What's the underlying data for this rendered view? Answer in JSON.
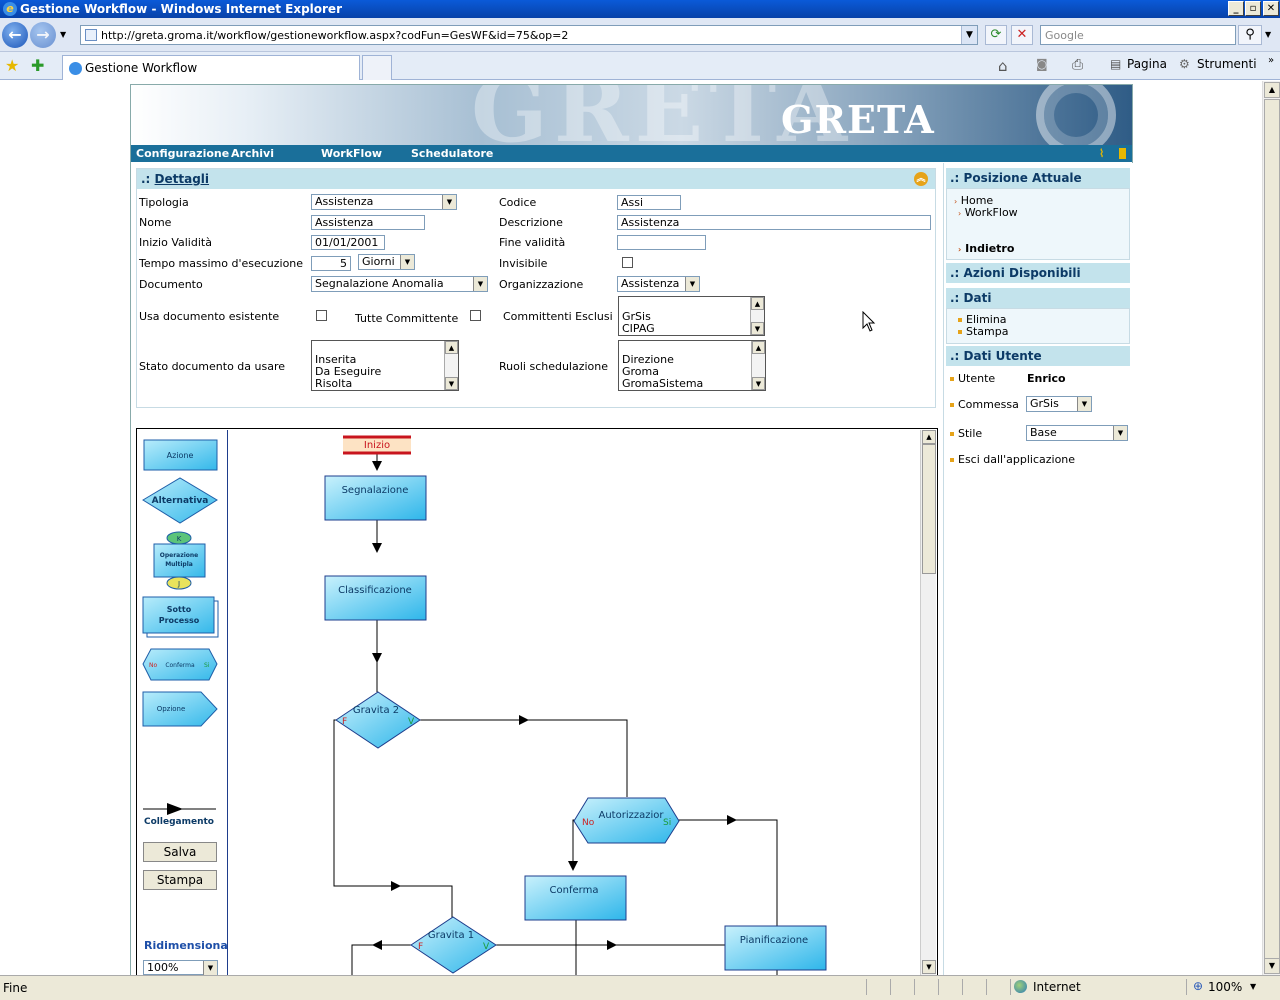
{
  "window": {
    "title": "Gestione Workflow - Windows Internet Explorer",
    "min": "_",
    "max": "▫",
    "close": "✕"
  },
  "nav": {
    "url": "http://greta.groma.it/workflow/gestioneworkflow.aspx?codFun=GesWF&id=75&op=2",
    "search_placeholder": "Google"
  },
  "tabs": [
    {
      "label": "Gestione Workflow"
    }
  ],
  "commands": {
    "pagina": "Pagina",
    "strumenti": "Strumenti"
  },
  "status": {
    "left": "Fine",
    "zone": "Internet",
    "zoom": "100%"
  },
  "app": {
    "logo": "GRETA",
    "menu": [
      "Configurazione",
      "Archivi",
      "WorkFlow",
      "Schedulatore"
    ]
  },
  "details": {
    "title": "Dettagli",
    "prefix": ".:",
    "tipologia": {
      "label": "Tipologia",
      "value": "Assistenza"
    },
    "codice": {
      "label": "Codice",
      "value": "Assi"
    },
    "nome": {
      "label": "Nome",
      "value": "Assistenza"
    },
    "descrizione": {
      "label": "Descrizione",
      "value": "Assistenza"
    },
    "inizio": {
      "label": "Inizio Validità",
      "value": "01/01/2001"
    },
    "fine": {
      "label": "Fine validità",
      "value": ""
    },
    "tempo": {
      "label": "Tempo massimo d'esecuzione",
      "value": "5",
      "unit": "Giorni"
    },
    "invisibile": {
      "label": "Invisibile"
    },
    "documento": {
      "label": "Documento",
      "value": "Segnalazione Anomalia"
    },
    "organizzazione": {
      "label": "Organizzazione",
      "value": "Assistenza"
    },
    "usa_doc": {
      "label": "Usa documento esistente"
    },
    "tutte": {
      "label": "Tutte Committente"
    },
    "committenti": {
      "label": "Committenti Esclusi",
      "items": [
        "GrSis",
        "CIPAG"
      ]
    },
    "stato": {
      "label": "Stato documento da usare",
      "items": [
        "Inserita",
        "Da Eseguire",
        "Risolta"
      ]
    },
    "ruoli": {
      "label": "Ruoli schedulazione",
      "items": [
        "Direzione",
        "Groma",
        "GromaSistema"
      ]
    }
  },
  "sidebar": {
    "posizione": {
      "title": ".: Posizione Attuale",
      "items": [
        "Home",
        "WorkFlow"
      ],
      "back": "Indietro"
    },
    "azioni": {
      "title": ".: Azioni Disponibili"
    },
    "dati": {
      "title": ".: Dati",
      "items": [
        "Elimina",
        "Stampa"
      ]
    },
    "utente": {
      "title": ".: Dati Utente",
      "utente_label": "Utente",
      "utente_value": "Enrico",
      "commessa_label": "Commessa",
      "commessa_value": "GrSis",
      "stile_label": "Stile",
      "stile_value": "Base",
      "exit": "Esci dall'applicazione"
    }
  },
  "palette": {
    "azione": "Azione",
    "alternativa": "Alternativa",
    "op_k": "K",
    "op_line1": "Operazione",
    "op_line2": "Multipla",
    "op_j": "J",
    "sotto_line1": "Sotto",
    "sotto_line2": "Processo",
    "conf_no": "No",
    "conferma": "Conferma",
    "conf_si": "Si",
    "opzione": "Opzione",
    "collegamento": "Collegamento",
    "salva": "Salva",
    "stampa": "Stampa",
    "ridimensiona": "Ridimensiona",
    "zoom": "100%"
  },
  "flow": {
    "inizio": "Inizio",
    "segnalazione": "Segnalazione",
    "classificazione": "Classificazione",
    "gravita2": "Gravita 2",
    "autorizzazione": "Autorizzazior",
    "conferma": "Conferma",
    "pianificazione": "Pianificazione",
    "gravita1": "Gravita 1",
    "f": "F",
    "v": "V",
    "no": "No",
    "si": "Si"
  },
  "colors": {
    "accent": "#1a6f9a",
    "panel_head": "#c3e3ec",
    "node": "#5ccaf0"
  }
}
